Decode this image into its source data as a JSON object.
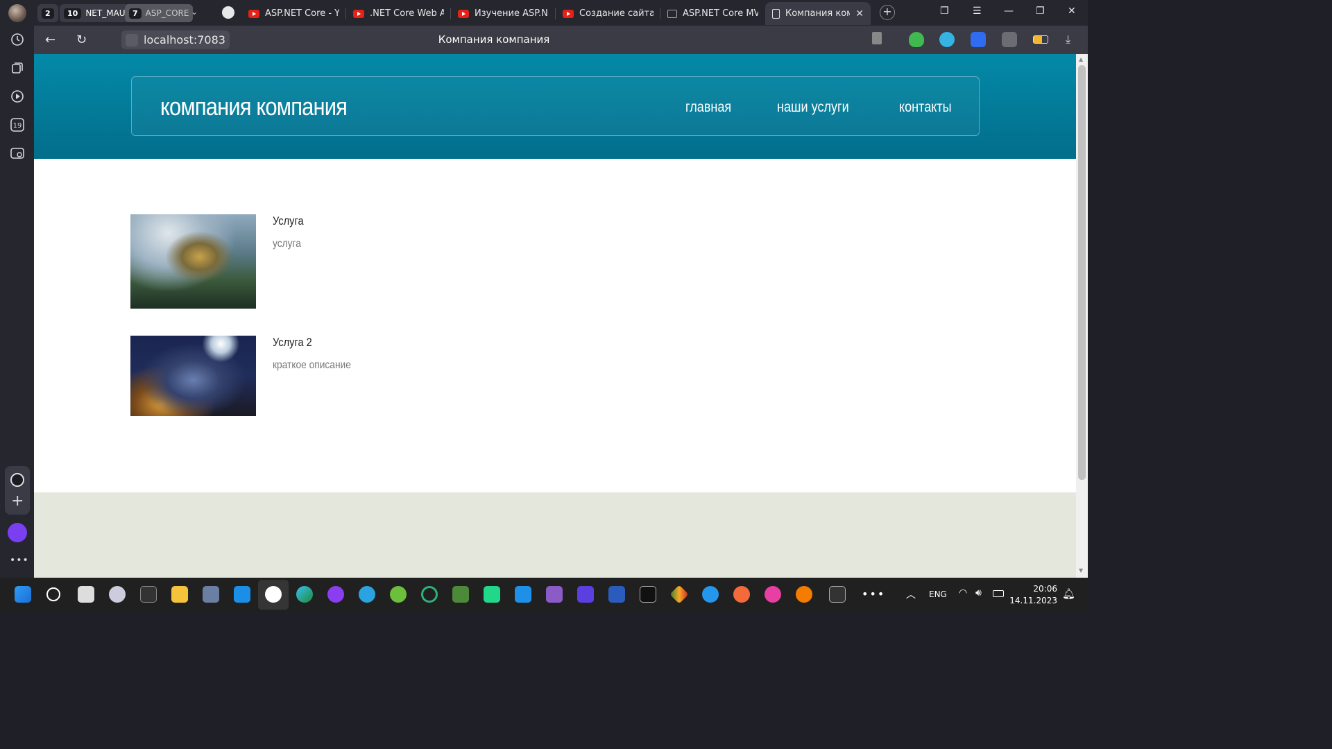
{
  "browser": {
    "tab_groups": [
      {
        "count": "2",
        "label": ""
      },
      {
        "count": "10",
        "label": "NET_MAUI"
      },
      {
        "count": "7",
        "label": "ASP_CORE"
      }
    ],
    "tabs": [
      {
        "title": "ASP.NET Core - Yo",
        "icon": "youtube-icon"
      },
      {
        "title": ".NET Core Web AI",
        "icon": "youtube-icon"
      },
      {
        "title": "Изучение ASP.NE",
        "icon": "youtube-icon"
      },
      {
        "title": "Создание сайта с",
        "icon": "youtube-icon"
      },
      {
        "title": "ASP.NET Core MV",
        "icon": "gmail-icon"
      },
      {
        "title": "Компания ком",
        "icon": "page-icon",
        "active": true
      }
    ],
    "address": "localhost:7083",
    "page_title": "Компания компания",
    "sidebar_badge": "19"
  },
  "site": {
    "brand": "компания компания",
    "nav": [
      "главная",
      "наши услуги",
      "контакты"
    ],
    "services": [
      {
        "name": "Услуга",
        "description": "услуга"
      },
      {
        "name": "Услуга 2",
        "description": "краткое описание"
      }
    ]
  },
  "taskbar": {
    "language": "ENG",
    "time": "20:06",
    "date": "14.11.2023"
  },
  "colors": {
    "header": "#0489a8",
    "footer": "#e3e7dc",
    "browser_chrome": "#3a3b44"
  }
}
